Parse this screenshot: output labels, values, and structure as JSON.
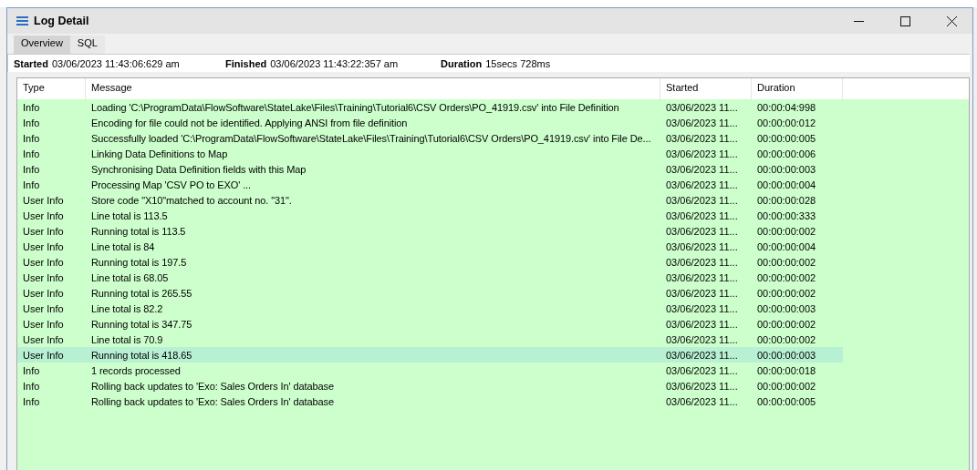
{
  "window": {
    "title": "Log Detail"
  },
  "tabs": [
    {
      "label": "Overview",
      "selected": true
    },
    {
      "label": "SQL",
      "selected": false
    }
  ],
  "summary": [
    {
      "label": "Started",
      "value": "03/06/2023 11:43:06:629 am"
    },
    {
      "label": "Finished",
      "value": "03/06/2023 11:43:22:357 am"
    },
    {
      "label": "Duration",
      "value": "15secs 728ms"
    }
  ],
  "table": {
    "columns": [
      "Type",
      "Message",
      "Started",
      "Duration"
    ],
    "rows": [
      {
        "type": "Info",
        "message": "Loading 'C:\\ProgramData\\FlowSoftware\\StateLake\\Files\\Training\\Tutorial6\\CSV Orders\\PO_41919.csv' into File Definition",
        "started": "03/06/2023 11...",
        "duration": "00:00:04:998",
        "selected": false
      },
      {
        "type": "Info",
        "message": "Encoding for file could not be identified.  Applying ANSI from file definition",
        "started": "03/06/2023 11...",
        "duration": "00:00:00:012",
        "selected": false
      },
      {
        "type": "Info",
        "message": "Successfully loaded 'C:\\ProgramData\\FlowSoftware\\StateLake\\Files\\Training\\Tutorial6\\CSV Orders\\PO_41919.csv' into File De...",
        "started": "03/06/2023 11...",
        "duration": "00:00:00:005",
        "selected": false
      },
      {
        "type": "Info",
        "message": "Linking Data Definitions to Map",
        "started": "03/06/2023 11...",
        "duration": "00:00:00:006",
        "selected": false
      },
      {
        "type": "Info",
        "message": "Synchronising Data Definition fields with this Map",
        "started": "03/06/2023 11...",
        "duration": "00:00:00:003",
        "selected": false
      },
      {
        "type": "Info",
        "message": "Processing Map 'CSV PO to EXO' ...",
        "started": "03/06/2023 11...",
        "duration": "00:00:00:004",
        "selected": false
      },
      {
        "type": "User Info",
        "message": "Store code \"X10\"matched to account no. \"31\".",
        "started": "03/06/2023 11...",
        "duration": "00:00:00:028",
        "selected": false
      },
      {
        "type": "User Info",
        "message": "Line total is 113.5",
        "started": "03/06/2023 11...",
        "duration": "00:00:00:333",
        "selected": false
      },
      {
        "type": "User Info",
        "message": "Running total is 113.5",
        "started": "03/06/2023 11...",
        "duration": "00:00:00:002",
        "selected": false
      },
      {
        "type": "User Info",
        "message": "Line total is 84",
        "started": "03/06/2023 11...",
        "duration": "00:00:00:004",
        "selected": false
      },
      {
        "type": "User Info",
        "message": "Running total is 197.5",
        "started": "03/06/2023 11...",
        "duration": "00:00:00:002",
        "selected": false
      },
      {
        "type": "User Info",
        "message": "Line total is 68.05",
        "started": "03/06/2023 11...",
        "duration": "00:00:00:002",
        "selected": false
      },
      {
        "type": "User Info",
        "message": "Running total is 265.55",
        "started": "03/06/2023 11...",
        "duration": "00:00:00:002",
        "selected": false
      },
      {
        "type": "User Info",
        "message": "Line total is 82.2",
        "started": "03/06/2023 11...",
        "duration": "00:00:00:003",
        "selected": false
      },
      {
        "type": "User Info",
        "message": "Running total is 347.75",
        "started": "03/06/2023 11...",
        "duration": "00:00:00:002",
        "selected": false
      },
      {
        "type": "User Info",
        "message": "Line total is 70.9",
        "started": "03/06/2023 11...",
        "duration": "00:00:00:002",
        "selected": false
      },
      {
        "type": "User Info",
        "message": "Running total is 418.65",
        "started": "03/06/2023 11...",
        "duration": "00:00:00:003",
        "selected": true
      },
      {
        "type": "Info",
        "message": "1 records processed",
        "started": "03/06/2023 11...",
        "duration": "00:00:00:018",
        "selected": false
      },
      {
        "type": "Info",
        "message": "Rolling back updates to 'Exo: Sales Orders In' database",
        "started": "03/06/2023 11...",
        "duration": "00:00:00:002",
        "selected": false
      },
      {
        "type": "Info",
        "message": "Rolling back updates to 'Exo: Sales Orders In' database",
        "started": "03/06/2023 11...",
        "duration": "00:00:00:005",
        "selected": false
      }
    ]
  }
}
